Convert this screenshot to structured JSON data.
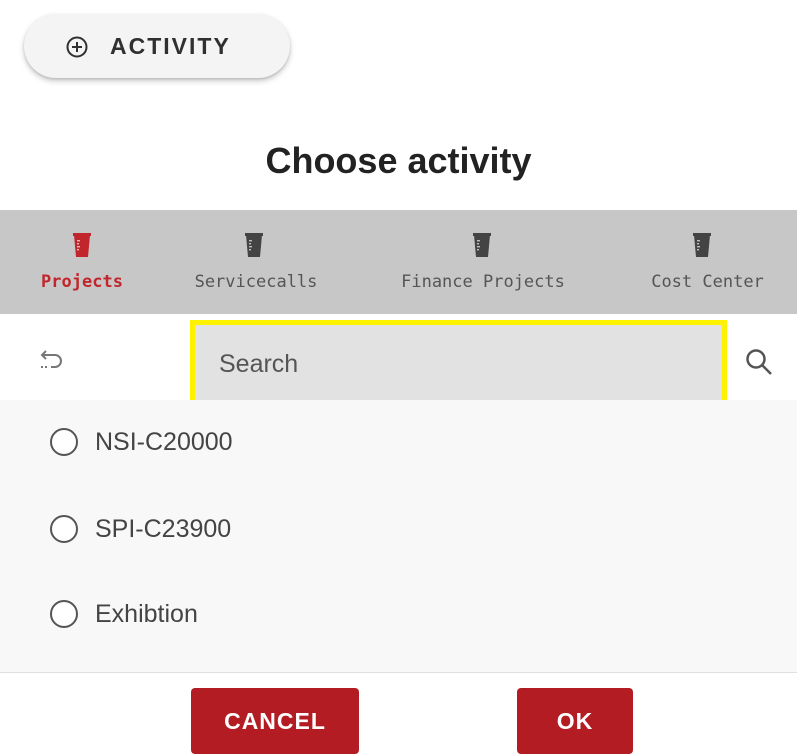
{
  "top_button": {
    "label": "ACTIVITY",
    "icon": "plus-circle-icon"
  },
  "dialog": {
    "title": "Choose activity"
  },
  "tabs": [
    {
      "label": "Projects",
      "icon": "bucket-icon",
      "active": true
    },
    {
      "label": "Servicecalls",
      "icon": "bucket-icon",
      "active": false
    },
    {
      "label": "Finance Projects",
      "icon": "bucket-icon",
      "active": false
    },
    {
      "label": "Cost Center",
      "icon": "bucket-icon",
      "active": false
    }
  ],
  "search": {
    "placeholder": "Search",
    "value": ""
  },
  "options": [
    {
      "label": "NSI-C20000",
      "selected": false
    },
    {
      "label": "SPI-C23900",
      "selected": false
    },
    {
      "label": "Exhibtion",
      "selected": false
    }
  ],
  "footer": {
    "cancel_label": "CANCEL",
    "ok_label": "OK"
  },
  "colors": {
    "accent": "#b31c22",
    "active_tab": "#c0262b",
    "tab_bar": "#c7c7c7",
    "search_highlight": "#fff200"
  }
}
